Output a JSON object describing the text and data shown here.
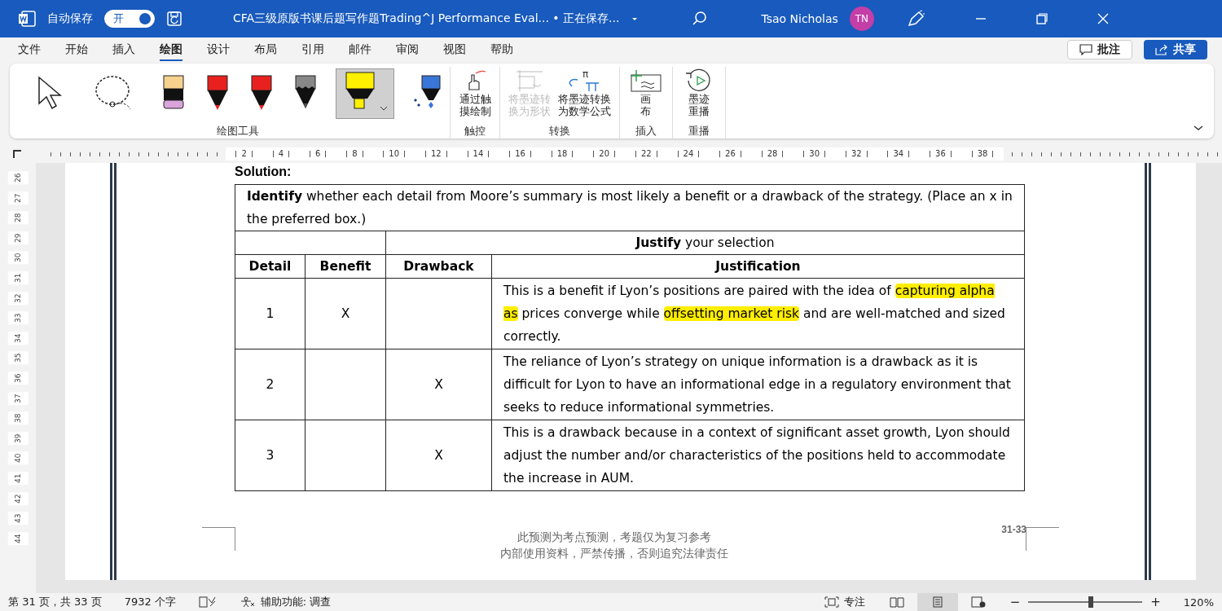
{
  "title_bar": {
    "autosave_label": "自动保存",
    "autosave_toggle": {
      "label": "开",
      "on": true
    },
    "document_title": "CFA三级原版书课后题写作题Trading^J Performance Eval... • 正在保存...",
    "user_name": "Tsao Nicholas",
    "avatar_initials": "TN"
  },
  "ribbon_tabs": [
    {
      "label": "文件",
      "selected": false
    },
    {
      "label": "开始",
      "selected": false
    },
    {
      "label": "插入",
      "selected": false
    },
    {
      "label": "绘图",
      "selected": true
    },
    {
      "label": "设计",
      "selected": false
    },
    {
      "label": "布局",
      "selected": false
    },
    {
      "label": "引用",
      "selected": false
    },
    {
      "label": "邮件",
      "selected": false
    },
    {
      "label": "审阅",
      "selected": false
    },
    {
      "label": "视图",
      "selected": false
    },
    {
      "label": "帮助",
      "selected": false
    }
  ],
  "comments_button": "批注",
  "share_button": "共享",
  "ribbon": {
    "drawing_tools": {
      "label": "绘图工具",
      "tools": [
        {
          "kind": "select",
          "selected": false
        },
        {
          "kind": "lasso",
          "selected": false
        },
        {
          "kind": "eraser",
          "selected": false
        },
        {
          "kind": "pen",
          "selected": false
        },
        {
          "kind": "pen",
          "selected": false
        },
        {
          "kind": "pencil",
          "selected": false
        },
        {
          "kind": "highlighter",
          "selected": true
        },
        {
          "kind": "action-pen",
          "selected": false
        }
      ]
    },
    "groups": [
      {
        "label": "触控",
        "buttons": [
          {
            "kind": "touch",
            "label": "通过触摸绘制",
            "disabled": false
          }
        ]
      },
      {
        "label": "转换",
        "buttons": [
          {
            "kind": "shape",
            "label": "将墨迹转换为形状",
            "disabled": true
          },
          {
            "kind": "math",
            "label": "将墨迹转换为数学公式",
            "disabled": false,
            "icon_symbol": "π"
          }
        ]
      },
      {
        "label": "插入",
        "buttons": [
          {
            "kind": "canvas",
            "label": "画布",
            "disabled": false
          }
        ]
      },
      {
        "label": "重播",
        "buttons": [
          {
            "kind": "replay",
            "label": "墨迹重播",
            "disabled": false
          }
        ]
      }
    ]
  },
  "ruler_labels": [
    "2",
    "4",
    "6",
    "8",
    "10",
    "12",
    "14",
    "16",
    "18",
    "20",
    "22",
    "24",
    "26",
    "28",
    "30",
    "32",
    "34",
    "36",
    "38"
  ],
  "vertical_ruler_labels": [
    "26",
    "27",
    "28",
    "29",
    "30",
    "31",
    "32",
    "33",
    "34",
    "35",
    "36",
    "37",
    "38",
    "39",
    "40",
    "41",
    "42",
    "43",
    "44"
  ],
  "document": {
    "heading": "Solution:",
    "instruction": "**Identify** whether each detail from Moore’s summary is most likely a benefit or a drawback of the strategy. (Place an x in the preferred box.)",
    "justify_header": "**Justify** your selection",
    "columns": [
      "Detail",
      "Benefit",
      "Drawback",
      "Justification"
    ],
    "rows": [
      {
        "detail": "1",
        "benefit": "X",
        "drawback": "",
        "justification": [
          {
            "text": "This is a benefit if Lyon’s positions are paired with the idea of ",
            "highlighted": false
          },
          {
            "text": "capturing alpha as",
            "highlighted": true
          },
          {
            "text": " prices converge while ",
            "highlighted": false
          },
          {
            "text": "offsetting market risk",
            "highlighted": true
          },
          {
            "text": " and are well-matched and sized correctly.",
            "highlighted": false
          }
        ]
      },
      {
        "detail": "2",
        "benefit": "",
        "drawback": "X",
        "justification": [
          {
            "text": "The reliance of Lyon’s strategy on unique information is a drawback as it is difficult for Lyon to have an informational edge in a regulatory environment that seeks to reduce informational symmetries.",
            "highlighted": false
          }
        ]
      },
      {
        "detail": "3",
        "benefit": "",
        "drawback": "X",
        "justification": [
          {
            "text": "This is a drawback because in a context of significant asset growth, Lyon should adjust the number and/or characteristics of the positions held to accommodate the increase in AUM.",
            "highlighted": false
          }
        ]
      }
    ],
    "footer_lines": [
      "此预测为考点预测，考题仅为复习参考",
      "内部使用资料，严禁传播，否则追究法律责任"
    ],
    "page_number": "31-33"
  },
  "status_bar": {
    "page": "第 31 页，共 33 页",
    "words": "7932 个字",
    "accessibility": "辅助功能: 调查",
    "focus": "专注",
    "views": [
      {
        "kind": "read",
        "selected": false
      },
      {
        "kind": "print",
        "selected": true
      },
      {
        "kind": "web",
        "selected": false
      }
    ],
    "zoom": {
      "level": 0.55
    },
    "zoom_out": "−",
    "zoom_in": "+",
    "zoom_text": "120%"
  }
}
